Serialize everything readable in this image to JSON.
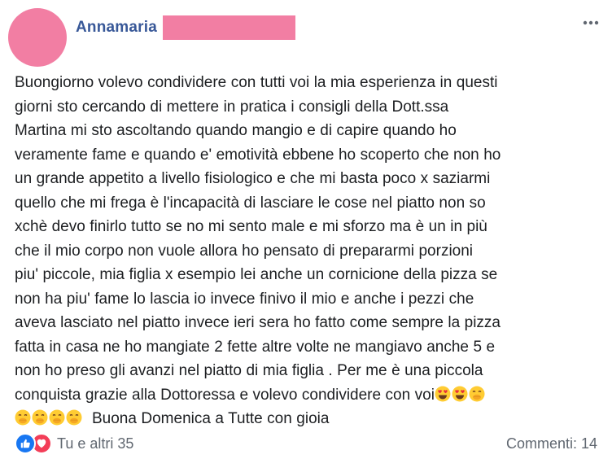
{
  "post": {
    "author": {
      "name": "Annamaria"
    },
    "more_icon": "more-options-icon",
    "text_lines": [
      "Buongiorno volevo condividere con tutti voi la mia esperienza in questi",
      "giorni sto cercando di mettere in pratica i consigli della Dott.ssa",
      "Martina mi sto ascoltando quando mangio e di capire quando ho",
      "veramente fame e quando e' emotività ebbene ho scoperto che non ho",
      "un grande appetito a livello fisiologico e che mi basta poco x saziarmi",
      "quello che mi frega è l'incapacità di lasciare le cose nel piatto non so",
      "xchè devo finirlo tutto se no mi sento male e mi sforzo ma è un in più",
      "che il mio corpo non vuole allora ho pensato di prepararmi porzioni",
      "piu' piccole, mia figlia x esempio lei anche un cornicione della pizza se",
      "non ha piu' fame lo lascia io invece finivo il mio e anche i pezzi che",
      "aveva lasciato nel piatto invece ieri sera ho fatto come sempre la pizza",
      "fatta in casa ne ho mangiate 2 fette altre volte ne mangiavo anche 5 e",
      "non ho preso gli avanzi nel piatto di mia figlia . Per me è una piccola",
      "conquista grazie alla Dottoressa e volevo condividere con voi"
    ],
    "last_line_text": "Buona Domenica a Tutte con gioia",
    "emoji_line_end": [
      "heart-eyes-emoji",
      "heart-eyes-emoji",
      "hand-over-mouth-emoji"
    ],
    "emoji_last_line_start": [
      "hand-over-mouth-emoji",
      "hand-over-mouth-emoji",
      "hand-over-mouth-emoji",
      "hand-over-mouth-emoji"
    ]
  },
  "footer": {
    "reactions_label": "Tu e altri 35",
    "reaction_icons": [
      "like-icon",
      "love-icon"
    ],
    "comments_label": "Commenti: 14"
  },
  "colors": {
    "author_link": "#385898",
    "redaction": "#f27ea3",
    "secondary_text": "#606770",
    "like_blue": "#1877f2",
    "love_red": "#f33e58"
  }
}
